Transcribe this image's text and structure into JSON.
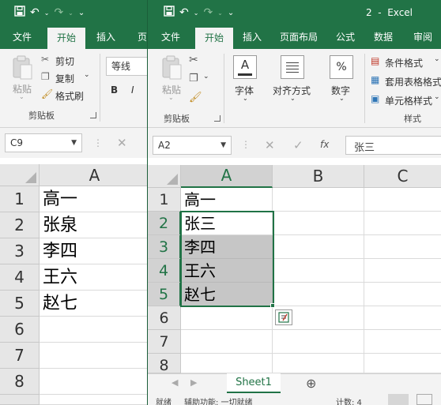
{
  "back_window": {
    "tabs": [
      "文件",
      "开始",
      "插入",
      "页"
    ],
    "clipboard": {
      "paste": "粘贴",
      "cut": "剪切",
      "copy": "复制",
      "format_painter": "格式刷",
      "group": "剪贴板"
    },
    "font_name": "等线",
    "name_box": "C9",
    "column": "A",
    "rows": [
      "1",
      "2",
      "3",
      "4",
      "5",
      "6",
      "7",
      "8"
    ],
    "cells": [
      "高一",
      "张泉",
      "李四",
      "王六",
      "赵七"
    ]
  },
  "front_window": {
    "title": "2  -  Excel",
    "tabs": [
      "文件",
      "开始",
      "插入",
      "页面布局",
      "公式",
      "数据",
      "审阅"
    ],
    "ribbon": {
      "paste": "粘贴",
      "clipboard_group": "剪贴板",
      "font": "字体",
      "alignment": "对齐方式",
      "number": "数字",
      "percent_symbol": "%",
      "font_letter": "A",
      "conditional_format": "条件格式",
      "table_format": "套用表格格式",
      "cell_styles": "单元格样式",
      "styles_group": "样式"
    },
    "name_box": "A2",
    "formula_value": "张三",
    "columns": [
      "A",
      "B",
      "C"
    ],
    "rows": [
      "1",
      "2",
      "3",
      "4",
      "5",
      "6",
      "7",
      "8"
    ],
    "cells": [
      "高一",
      "张三",
      "李四",
      "王六",
      "赵七"
    ],
    "sheet_tab": "Sheet1",
    "status": {
      "ready": "就绪",
      "accessibility": "辅助功能: 一切就绪",
      "count": "计数: 4"
    }
  },
  "colors": {
    "brand_green": "#217346",
    "selection_gray": "#c6c6c6",
    "header_gray": "#e6e6e6"
  }
}
